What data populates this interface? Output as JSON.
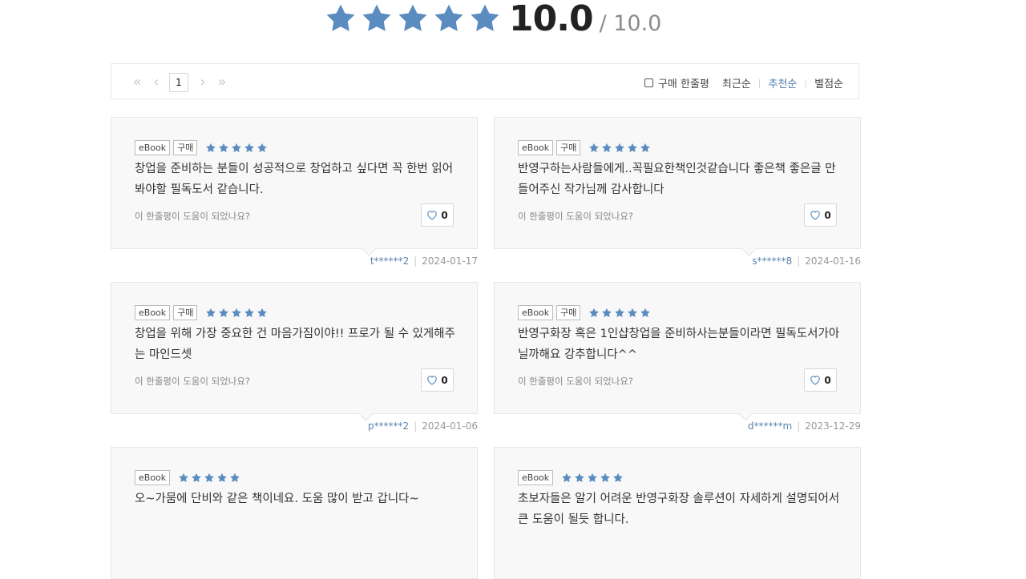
{
  "rating": {
    "score": "10.0",
    "max": "/ 10.0",
    "stars": 5,
    "star_color": "#5b8cc0"
  },
  "pager": {
    "first_icon": "«",
    "prev_icon": "‹",
    "current_page": "1",
    "next_icon": "›",
    "last_icon": "»"
  },
  "sort": {
    "purchase_filter_label": "구매 한줄평",
    "options": [
      "최근순",
      "추천순",
      "별점순"
    ],
    "active": "추천순"
  },
  "helpful_prompt": "이 한줄평이 도움이 되었나요?",
  "reviews": [
    {
      "tags": [
        "eBook",
        "구매"
      ],
      "stars": 5,
      "text": "창업을 준비하는 분들이 성공적으로 창업하고 싶다면 꼭 한번 읽어봐야할 필독도서 같습니다.",
      "likes": "0",
      "user": "t******2",
      "date": "2024-01-17"
    },
    {
      "tags": [
        "eBook",
        "구매"
      ],
      "stars": 5,
      "text": "반영구하는사람들에게..꼭필요한책인것같습니다  좋은책  좋은글 만들어주신 작가님께 감사합니다",
      "likes": "0",
      "user": "s******8",
      "date": "2024-01-16"
    },
    {
      "tags": [
        "eBook",
        "구매"
      ],
      "stars": 5,
      "text": "창업을 위해 가장 중요한 건 마음가짐이야!! 프로가 될 수 있게해주는 마인드셋",
      "likes": "0",
      "user": "p******2",
      "date": "2024-01-06"
    },
    {
      "tags": [
        "eBook",
        "구매"
      ],
      "stars": 5,
      "text": "반영구화장 혹은 1인샵창업을 준비하사는분들이라면 필독도서가아닐까해요 강추합니다^^",
      "likes": "0",
      "user": "d******m",
      "date": "2023-12-29"
    },
    {
      "tags": [
        "eBook"
      ],
      "stars": 5,
      "text": "오~가뭄에 단비와 같은 책이네요. 도움 많이 받고 갑니다~",
      "likes": "",
      "user": "",
      "date": ""
    },
    {
      "tags": [
        "eBook"
      ],
      "stars": 5,
      "text": "초보자들은 알기 어려운 반영구화장 솔루션이 자세하게 설명되어서 큰 도움이 될듯 합니다.",
      "likes": "",
      "user": "",
      "date": ""
    }
  ]
}
